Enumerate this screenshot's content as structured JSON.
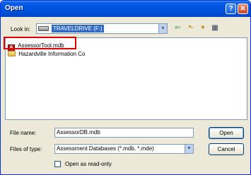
{
  "window": {
    "title": "Open",
    "help_glyph": "?",
    "close_glyph": "✕"
  },
  "toolbar": {
    "look_in_label": "Look in:",
    "look_in_value": "TRAVELDRIVE (F:)",
    "dropdown_glyph": "▼",
    "back_icon": "back-arrow-icon",
    "up_icon": "up-folder-icon",
    "new_folder_icon": "new-folder-icon",
    "views_icon": "views-menu-icon"
  },
  "files": [
    {
      "name": "AssessorTool.mdb",
      "icon": "access-database-icon"
    },
    {
      "name": "Hazardville Information Co",
      "icon": "folder-icon"
    }
  ],
  "form": {
    "file_name_label": "File name:",
    "file_name_value": "AssessorDB.mdb",
    "file_type_label": "Files of type:",
    "file_type_value": "Assessment Databases (*.mdb, *.mde)",
    "open_button": "Open",
    "cancel_button": "Cancel",
    "readonly_label": "Open as read-only",
    "readonly_checked": false
  },
  "colors": {
    "titlebar": "#0054e3",
    "selection": "#316ac5",
    "highlight_box": "#e00000"
  }
}
